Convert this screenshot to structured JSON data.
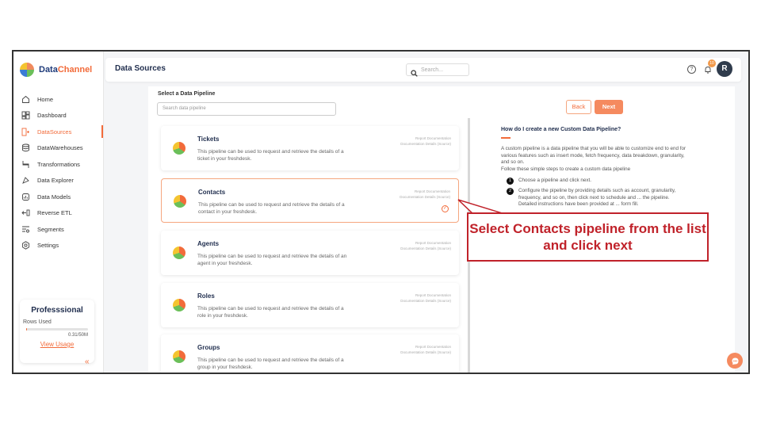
{
  "app": {
    "name_part1": "Data",
    "name_part2": "Channel"
  },
  "header": {
    "title": "Data Sources",
    "search_placeholder": "Search...",
    "notification_count": "10",
    "avatar_initial": "R"
  },
  "sidebar": {
    "items": [
      {
        "label": "Home",
        "icon": "home-icon"
      },
      {
        "label": "Dashboard",
        "icon": "dashboard-icon"
      },
      {
        "label": "DataSources",
        "icon": "datasources-icon",
        "active": true
      },
      {
        "label": "DataWarehouses",
        "icon": "database-icon"
      },
      {
        "label": "Transformations",
        "icon": "transform-icon"
      },
      {
        "label": "Data Explorer",
        "icon": "explorer-icon"
      },
      {
        "label": "Data Models",
        "icon": "models-icon"
      },
      {
        "label": "Reverse ETL",
        "icon": "reverse-etl-icon"
      },
      {
        "label": "Segments",
        "icon": "segments-icon"
      },
      {
        "label": "Settings",
        "icon": "gear-icon"
      }
    ],
    "plan": {
      "name": "Professsional",
      "rows_label": "Rows Used",
      "rows_value": "0.31/50M",
      "rows_fraction": 0.006,
      "view_usage": "View Usage"
    },
    "collapse_glyph": "«"
  },
  "main": {
    "select_label": "Select a Data Pipeline",
    "search_placeholder": "Search data pipeline",
    "back_label": "Back",
    "next_label": "Next",
    "pipelines": [
      {
        "title": "Tickets",
        "desc": "This pipeline can be used to request and retrieve the details of a ticket in your freshdesk.",
        "link1": "Report Documentation",
        "link2": "Documentation Details (Source)",
        "selected": false
      },
      {
        "title": "Contacts",
        "desc": "This pipeline can be used to request and retrieve the details of a contact in your freshdesk.",
        "link1": "Report Documentation",
        "link2": "Documentation Details (Source)",
        "selected": true
      },
      {
        "title": "Agents",
        "desc": "This pipeline can be used to request and retrieve the details of an agent in your freshdesk.",
        "link1": "Report Documentation",
        "link2": "Documentation Details (Source)",
        "selected": false
      },
      {
        "title": "Roles",
        "desc": "This pipeline can be used to request and retrieve the details of a role in your freshdesk.",
        "link1": "Report Documentation",
        "link2": "Documentation Details (Source)",
        "selected": false
      },
      {
        "title": "Groups",
        "desc": "This pipeline can be used to request and retrieve the details of a group in your freshdesk.",
        "link1": "Report Documentation",
        "link2": "Documentation Details (Source)",
        "selected": false
      }
    ],
    "info": {
      "title": "How do I create a new Custom Data Pipeline?",
      "body": "A custom pipeline is a data pipeline that you will be able to customize end to end for various features such as insert mode, fetch frequency, data breakdown, granularity, and so on.",
      "body2": "Follow these simple steps to create a custom data pipeline",
      "steps": [
        {
          "num": "1",
          "text": "Choose a pipeline and click next."
        },
        {
          "num": "2",
          "text": "Configure the pipeline by providing details such as account, granularity, frequency, and so on, then click next to schedule and ... the pipeline. Detailed instructions have been provided at ... form fill."
        }
      ]
    }
  },
  "annotation": {
    "text": "Select Contacts pipeline from the list and click next",
    "color": "#c0222a"
  },
  "colors": {
    "accent": "#f26b3a",
    "navy": "#1f2d4d"
  }
}
